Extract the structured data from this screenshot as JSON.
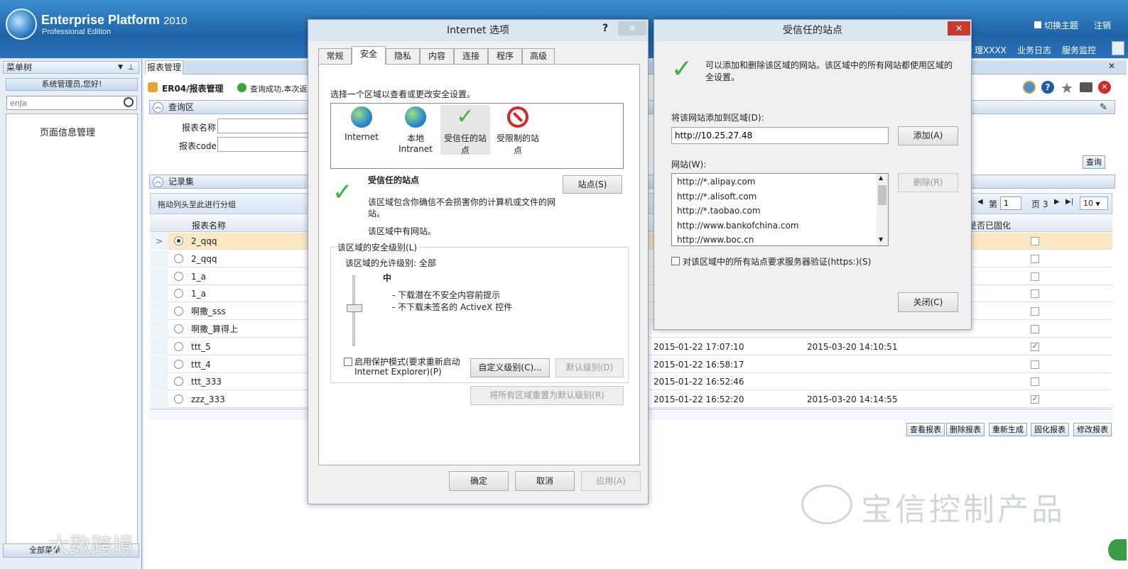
{
  "header": {
    "app_name": "Enterprise Platform",
    "year": "2010",
    "edition": "Professional Edition",
    "switch_theme": "切换主题",
    "logout": "注销",
    "nav_partial": "理XXXX",
    "nav_log": "业务日志",
    "nav_monitor": "服务监控"
  },
  "sidebar": {
    "title": "菜单树",
    "greeting": "系统管理员,您好!",
    "search_placeholder": "enJa",
    "item": "页面信息管理",
    "footer": "全部菜单"
  },
  "main": {
    "tab": "报表管理",
    "breadcrumb": "ER04/报表管理",
    "status": "查询成功,本次返",
    "query_section": "查询区",
    "field_name": "报表名称",
    "field_code": "报表code",
    "query_button": "查询",
    "records_section": "记录集",
    "group_hint": "拖动列头至此进行分组",
    "col_name": "报表名称",
    "col_fixed": "表是否已固化",
    "pager": {
      "label_page": "第",
      "page": "1",
      "label_total": "页 3",
      "size": "10"
    },
    "rows": [
      {
        "name": "2_qqq",
        "t1": "",
        "t2": "",
        "checked": ""
      },
      {
        "name": "2_qqq",
        "t1": "",
        "t2": "",
        "checked": ""
      },
      {
        "name": "1_a",
        "t1": "",
        "t2": "",
        "checked": ""
      },
      {
        "name": "1_a",
        "t1": "",
        "t2": "",
        "checked": ""
      },
      {
        "name": "啊撒_sss",
        "t1": "",
        "t2": "",
        "checked": ""
      },
      {
        "name": "啊撒_算得上",
        "t1": "",
        "t2": "",
        "checked": ""
      },
      {
        "name": "ttt_5",
        "t1": "2015-01-22 17:07:10",
        "t2": "2015-03-20 14:10:51",
        "checked": "✓"
      },
      {
        "name": "ttt_4",
        "t1": "2015-01-22 16:58:17",
        "t2": "",
        "checked": ""
      },
      {
        "name": "ttt_333",
        "t1": "2015-01-22 16:52:46",
        "t2": "",
        "checked": ""
      },
      {
        "name": "zzz_333",
        "t1": "2015-01-22 16:52:20",
        "t2": "2015-03-20 14:14:55",
        "checked": "✓"
      }
    ],
    "actions": [
      "查看报表",
      "删除报表",
      "重新生成",
      "固化报表",
      "修改报表"
    ]
  },
  "inet_dialog": {
    "title": "Internet 选项",
    "help": "?",
    "tabs": [
      "常规",
      "安全",
      "隐私",
      "内容",
      "连接",
      "程序",
      "高级"
    ],
    "instruction": "选择一个区域以查看或更改安全设置。",
    "zones": [
      {
        "l1": "Internet",
        "l2": ""
      },
      {
        "l1": "本地",
        "l2": "Intranet"
      },
      {
        "l1": "受信任的站",
        "l2": "点"
      },
      {
        "l1": "受限制的站",
        "l2": "点"
      }
    ],
    "zone_title": "受信任的站点",
    "zone_desc1": "该区域包含你确信不会损害你的计算机或文件的网",
    "zone_desc2": "站。",
    "zone_has_sites": "该区域中有网站。",
    "sites_button": "站点(S)",
    "level_group": "该区域的安全级别(L)",
    "allowed": "该区域的允许级别: 全部",
    "level": "中",
    "bullet1": "- 下载潜在不安全内容前提示",
    "bullet2": "- 不下载未签名的 ActiveX 控件",
    "protect1": "启用保护模式(要求重新启动",
    "protect2": "Internet Explorer)(P)",
    "custom_btn": "自定义级别(C)...",
    "default_btn": "默认级别(D)",
    "reset_btn": "将所有区域重置为默认级别(R)",
    "ok": "确定",
    "cancel": "取消",
    "apply": "应用(A)"
  },
  "trusted_dialog": {
    "title": "受信任的站点",
    "close_x": "✕",
    "info1": "可以添加和删除该区域的网站。该区域中的所有网站都使用区域的",
    "info2": "全设置。",
    "add_label": "将该网站添加到区域(D):",
    "url_value": "http://10.25.27.48",
    "add_btn": "添加(A)",
    "sites_label": "网站(W):",
    "sites": [
      "http://*.alipay.com",
      "http://*.alisoft.com",
      "http://*.taobao.com",
      "http://www.bankofchina.com",
      "http://www.boc.cn"
    ],
    "remove_btn": "删除(R)",
    "https_label": "对该区域中的所有站点要求服务器验证(https:)(S)",
    "close_btn": "关闭(C)"
  },
  "watermark": {
    "right": "宝信控制产品",
    "left": "大数跨境"
  }
}
